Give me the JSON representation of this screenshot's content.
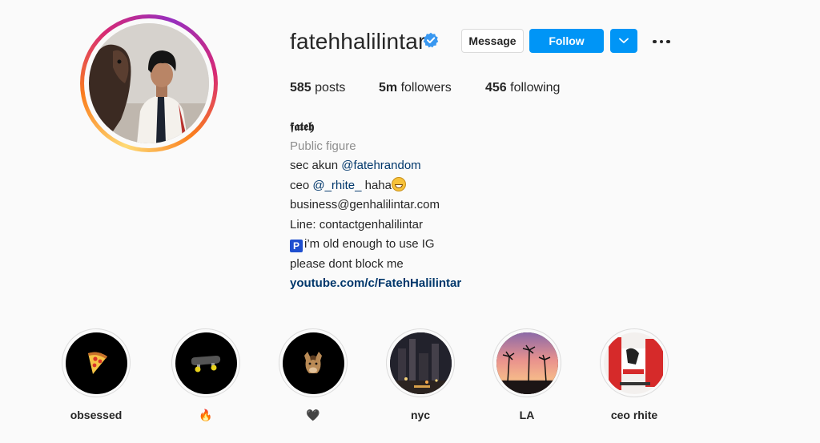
{
  "profile": {
    "username": "fatehhalilintar",
    "verified": true,
    "buttons": {
      "message": "Message",
      "follow": "Follow"
    },
    "icons": {
      "verified": "verified-badge-icon",
      "dropdown": "chevron-down-icon",
      "more": "more-options-icon"
    },
    "stats": {
      "posts_count": "585",
      "posts_label": "posts",
      "followers_count": "5m",
      "followers_label": "followers",
      "following_count": "456",
      "following_label": "following"
    },
    "bio": {
      "name": "𝖋𝖆𝖙𝖊𝖍",
      "category": "Public figure",
      "line1_prefix": "sec akun ",
      "line1_mention": "@fatehrandom",
      "line2_prefix": "ceo ",
      "line2_mention": "@_rhite_",
      "line2_suffix": " haha",
      "line3": "business@genhalilintar.com",
      "line4": "Line: contactgenhalilintar",
      "line5_badge": "P",
      "line5": "i’m old enough to use IG",
      "line6": "please dont block me",
      "link": "youtube.com/c/FatehHalilintar"
    }
  },
  "highlights": [
    {
      "label": "obsessed",
      "icon": "pizza-icon"
    },
    {
      "label": "🔥",
      "icon": "skateboard-icon"
    },
    {
      "label": "🖤",
      "icon": "horse-icon"
    },
    {
      "label": "nyc",
      "icon": "nyc-city-thumbnail"
    },
    {
      "label": "LA",
      "icon": "la-palm-sunset-thumbnail"
    },
    {
      "label": "ceo rhite",
      "icon": "peace-poster-thumbnail"
    }
  ],
  "colors": {
    "follow_blue": "#0095f6",
    "link_blue": "#00376b",
    "category_gray": "#8e8e8e",
    "background": "#fafafa"
  }
}
